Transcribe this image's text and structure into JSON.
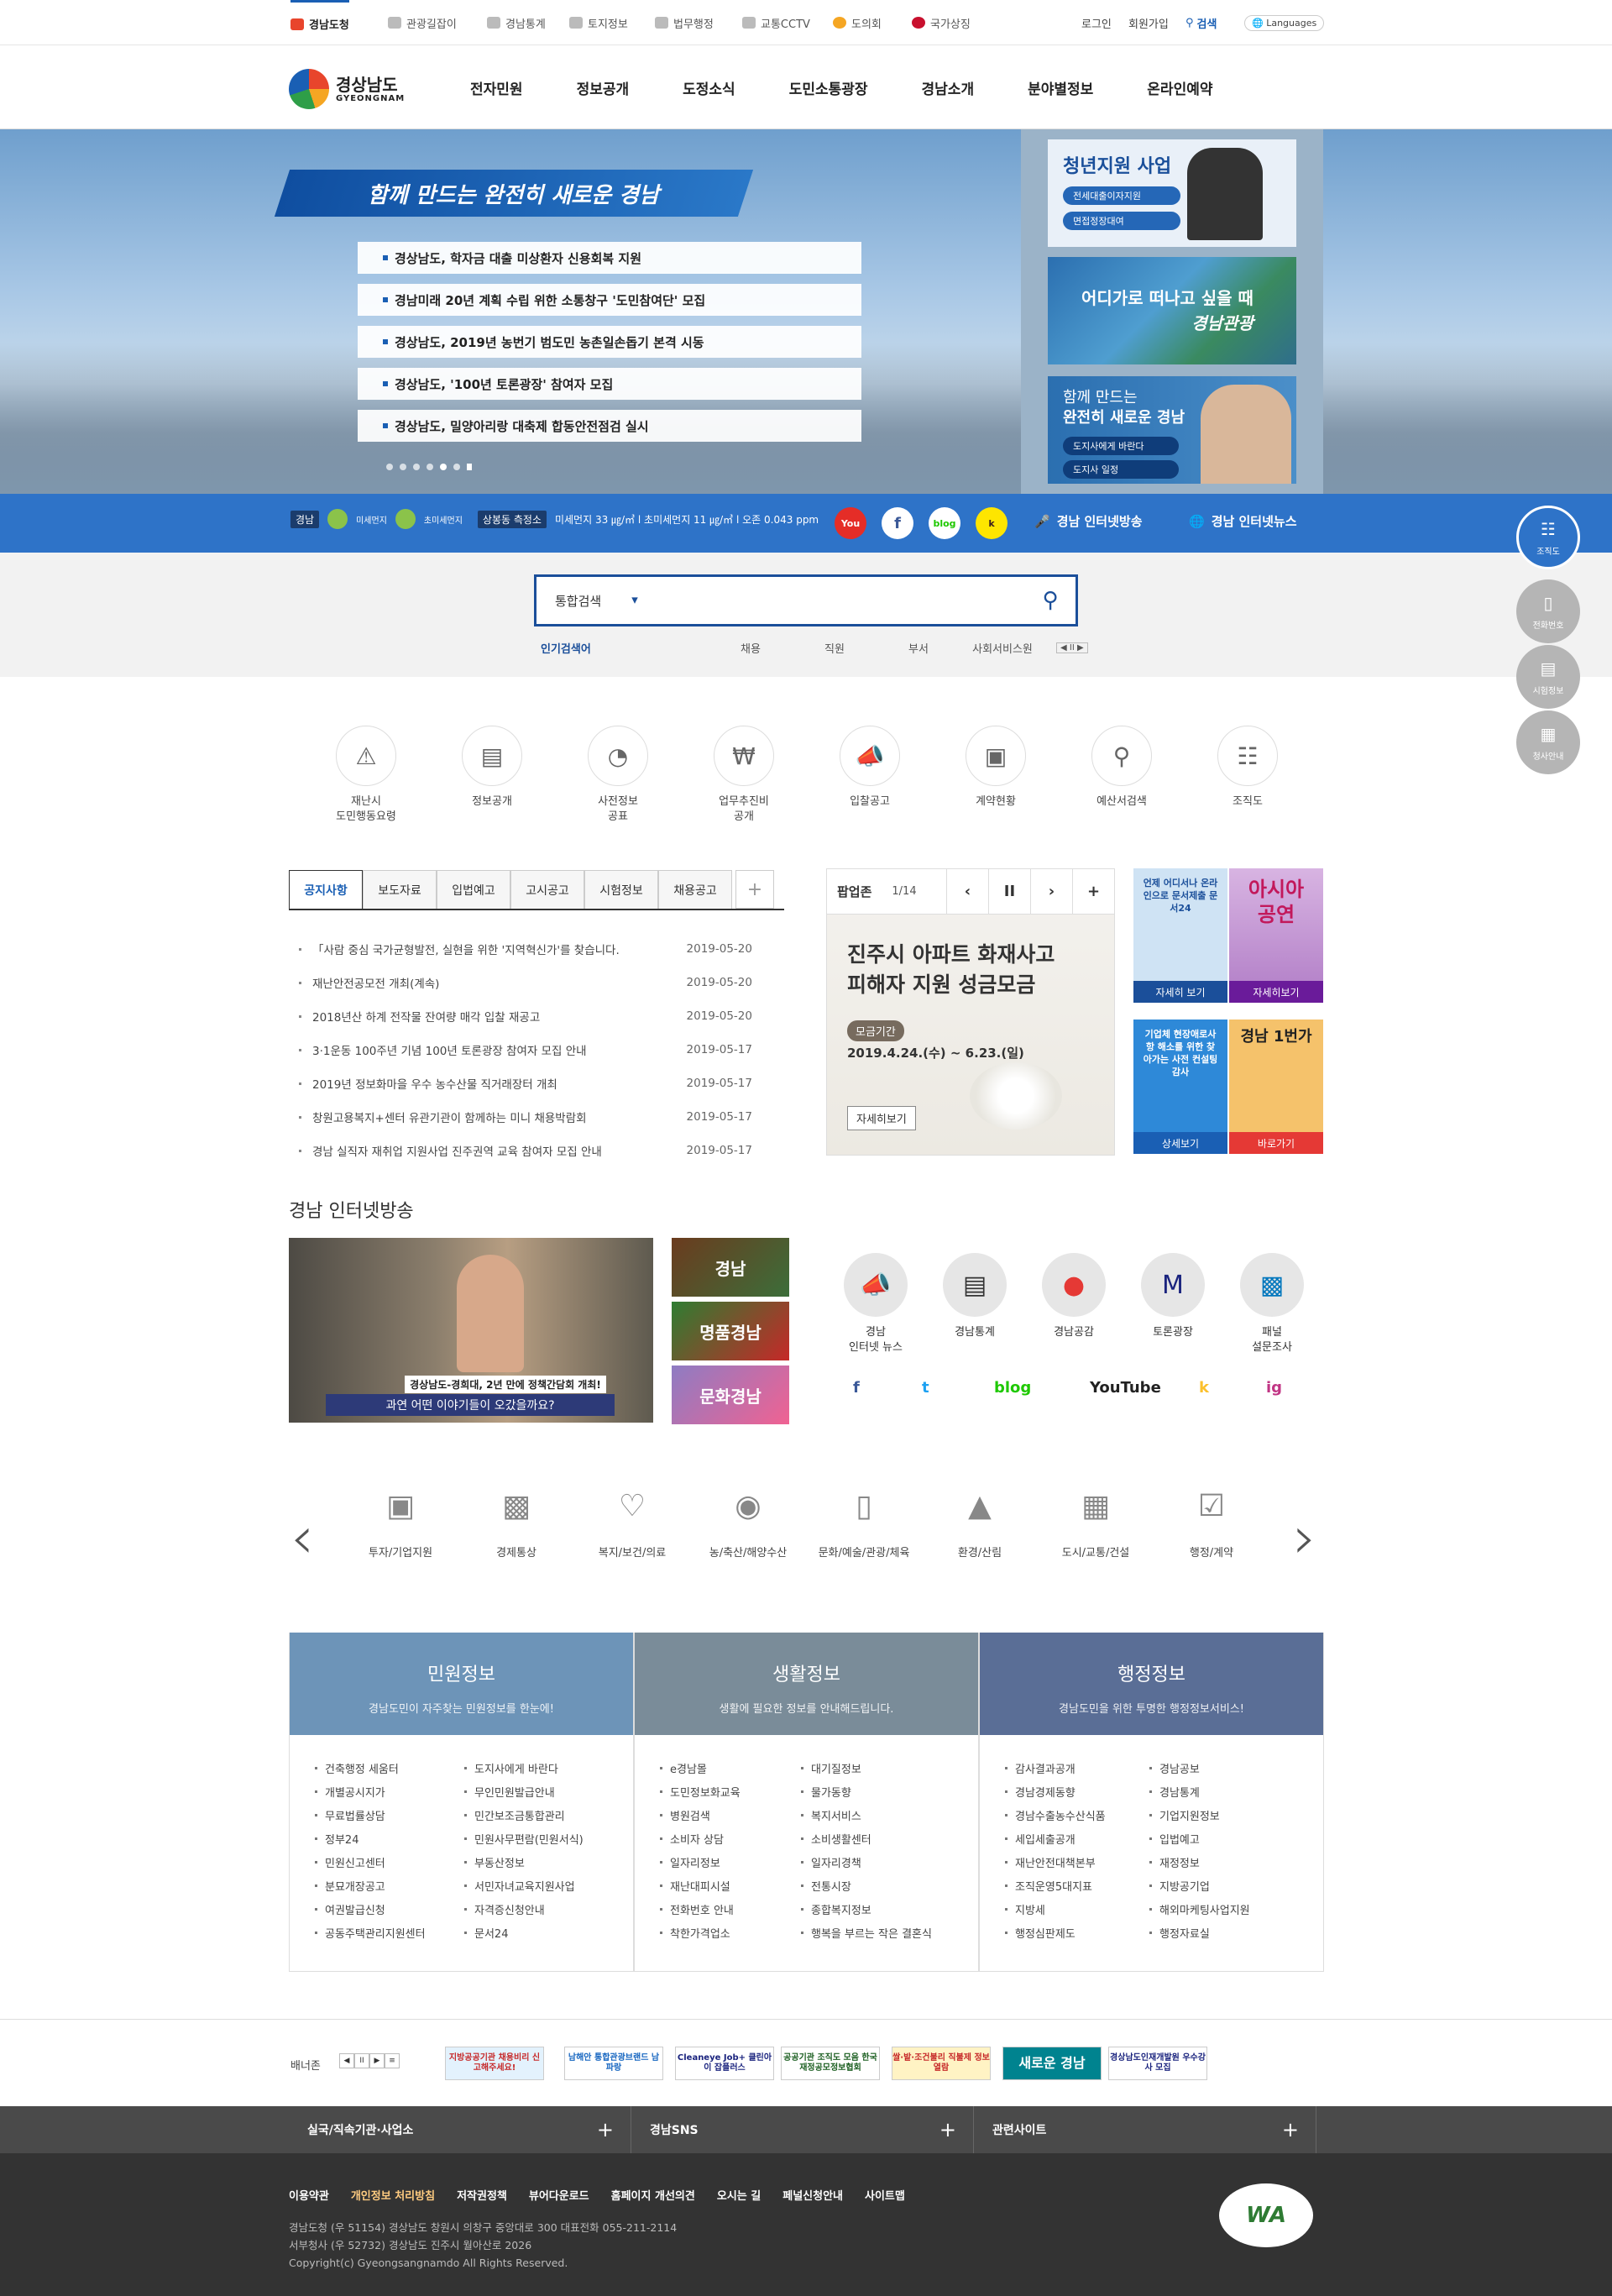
{
  "util": {
    "tabs": [
      {
        "label": "경남도청",
        "icon": "gyeongnam-logo-icon"
      },
      {
        "label": "관광길잡이",
        "icon": "camera-icon"
      },
      {
        "label": "경남통계",
        "icon": "bar-chart-icon"
      },
      {
        "label": "토지정보",
        "icon": "land-icon"
      },
      {
        "label": "법무행정",
        "icon": "scale-icon"
      },
      {
        "label": "교통CCTV",
        "icon": "car-icon"
      },
      {
        "label": "도의회",
        "icon": "assembly-icon"
      },
      {
        "label": "국가상징",
        "icon": "flag-icon"
      }
    ],
    "login": "로그인",
    "join": "회원가입",
    "search": "검색",
    "languages": "Languages"
  },
  "logo": {
    "kr": "경상남도",
    "en": "GYEONGNAM"
  },
  "menu": [
    "전자민원",
    "정보공개",
    "도정소식",
    "도민소통광장",
    "경남소개",
    "분야별정보",
    "온라인예약"
  ],
  "hero": {
    "slogan": "함께 만드는 완전히 새로운 경남",
    "news": [
      "경상남도, 학자금 대출 미상환자 신용회복 지원",
      "경남미래 20년 계획 수립 위한 소통창구 '도민참여단' 모집",
      "경상남도, 2019년 농번기 범도민 농촌일손돕기 본격 시동",
      "경상남도, '100년 토론광장' 참여자 모집",
      "경상남도, 밀양아리랑 대축제 합동안전점검 실시"
    ],
    "banner1": {
      "title": "청년지원 사업",
      "btn1": "전세대출이자지원",
      "btn2": "면접정장대여"
    },
    "banner2": {
      "text1": "어디가로 떠나고 싶을 때",
      "text2": "경남관광"
    },
    "banner3": {
      "text1": "함께 만드는",
      "text2": "완전히 새로운 경남",
      "btn1": "도지사에게 바란다",
      "btn2": "도지사 일정"
    }
  },
  "strip": {
    "brand": "경남",
    "icon1": "미세먼지",
    "icon2": "초미세먼지",
    "station": "상봉동 측정소",
    "air": "미세먼지 33 ㎍/㎥ l 초미세먼지 11 ㎍/㎥ l 오존 0.043 ppm",
    "link1": "경남 인터넷방송",
    "link2": "경남 인터넷뉴스"
  },
  "search": {
    "scope": "통합검색",
    "popular_label": "인기검색어",
    "keywords": [
      "채용",
      "직원",
      "부서",
      "사회서비스원"
    ]
  },
  "quick": [
    [
      "재난시",
      "도민행동요령"
    ],
    [
      "정보공개",
      ""
    ],
    [
      "사전정보",
      "공표"
    ],
    [
      "업무추진비",
      "공개"
    ],
    [
      "입찰공고",
      ""
    ],
    [
      "계약현황",
      ""
    ],
    [
      "예산서검색",
      ""
    ],
    [
      "조직도",
      ""
    ]
  ],
  "notice": {
    "tabs": [
      "공지사항",
      "보도자료",
      "입법예고",
      "고시공고",
      "시험정보",
      "채용공고"
    ],
    "items": [
      {
        "title": "「사람 중심 국가균형발전, 실현을 위한 '지역혁신가'를 찾습니다.",
        "date": "2019-05-20"
      },
      {
        "title": "재난안전공모전 개최(계속)",
        "date": "2019-05-20"
      },
      {
        "title": "2018년산 하계 전작물 잔여량 매각 입찰 재공고",
        "date": "2019-05-20"
      },
      {
        "title": "3·1운동 100주년 기념 100년 토론광장 참여자 모집 안내",
        "date": "2019-05-17"
      },
      {
        "title": "2019년 정보화마을 우수 농수산물 직거래장터 개최",
        "date": "2019-05-17"
      },
      {
        "title": "창원고용복지+센터 유관기관이 함께하는 미니 채용박람회",
        "date": "2019-05-17"
      },
      {
        "title": "경남 실직자 재취업 지원사업 진주권역 교육 참여자 모집 안내",
        "date": "2019-05-17"
      }
    ]
  },
  "popupzone": {
    "label": "팝업존",
    "page": "1/14",
    "title1": "진주시 아파트 화재사고",
    "title2": "피해자 지원 성금모금",
    "tag": "모금기간",
    "period": "2019.4.24.(수) ~ 6.23.(일)",
    "more": "자세히보기"
  },
  "side_banners": [
    {
      "text": "언제 어디서나 온라인으로 문서제출 문서24",
      "cap": "자세히 보기"
    },
    {
      "text": "아시아 공연",
      "cap": "자세히보기"
    },
    {
      "text": "기업체 현장애로사항 해소를 위한 찾아가는 사전 컨설팅감사",
      "cap": "상세보기"
    },
    {
      "text": "경남 1번가",
      "cap": "바로가기"
    }
  ],
  "broadcast": {
    "title": "경남 인터넷방송",
    "sub1": "경상남도-경희대, 2년 만에 정책간담회 개최!",
    "sub2": "과연 어떤 이야기들이 오갔을까요?",
    "thumbs": [
      "경남",
      "명품경남",
      "문화경남"
    ],
    "icons": [
      [
        "경남",
        "인터넷 뉴스"
      ],
      [
        "경남통계",
        ""
      ],
      [
        "경남공감",
        ""
      ],
      [
        "토론광장",
        ""
      ],
      [
        "패널",
        "설문조사"
      ]
    ],
    "sns": [
      "f",
      "t",
      "blog",
      "YouTube",
      "k",
      "ig"
    ]
  },
  "fields": [
    "투자/기업지원",
    "경제통상",
    "복지/보건/의료",
    "농/축산/해양수산",
    "문화/예술/관광/체육",
    "환경/산림",
    "도시/교통/건설",
    "행정/계약"
  ],
  "info": [
    {
      "title": "민원정보",
      "sub": "경남도민이 자주찾는 민원정보를 한눈에!",
      "color": "#6d94b8",
      "left": [
        "건축행정 세움터",
        "개별공시지가",
        "무료법률상담",
        "정부24",
        "민원신고센터",
        "분묘개장공고",
        "여권발급신청",
        "공동주택관리지원센터"
      ],
      "right": [
        "도지사에게 바란다",
        "무인민원발급안내",
        "민간보조금통합관리",
        "민원사무편람(민원서식)",
        "부동산정보",
        "서민자녀교육지원사업",
        "자격증신청안내",
        "문서24"
      ]
    },
    {
      "title": "생활정보",
      "sub": "생활에 필요한 정보를 안내해드립니다.",
      "color": "#7a8c99",
      "left": [
        "e경남몰",
        "도민정보화교육",
        "병원검색",
        "소비자 상담",
        "일자리정보",
        "재난대피시설",
        "전화번호 안내",
        "착한가격업소"
      ],
      "right": [
        "대기질정보",
        "물가동향",
        "복지서비스",
        "소비생활센터",
        "일자리경책",
        "전통시장",
        "종합복지정보",
        "행복을 부르는 작은 결혼식"
      ]
    },
    {
      "title": "행정정보",
      "sub": "경남도민을 위한 투명한 행정정보서비스!",
      "color": "#5a6e96",
      "left": [
        "감사결과공개",
        "경남경제동향",
        "경남수출농수산식품",
        "세입세출공개",
        "재난안전대책본부",
        "조직운영5대지표",
        "지방세",
        "행정심판제도"
      ],
      "right": [
        "경남공보",
        "경남통계",
        "기업지원정보",
        "입법예고",
        "재정정보",
        "지방공기업",
        "해외마케팅사업지원",
        "행정자료실"
      ]
    }
  ],
  "bannerzone": {
    "label": "배너존",
    "items": [
      "지방공공기관 채용비리 신고해주세요!",
      "남해안 통합관광브랜드 남파랑",
      "Cleaneye Job+ 클린아이 잡플러스",
      "공공기관 조직도 모음 한국재정공모정보협회",
      "쌀·밭·조건불리 직불제 정보열람",
      "새로운 경남",
      "경상남도인재개발원 우수강사 모집"
    ]
  },
  "footer_bar": [
    "실국/직속기관·사업소",
    "경남SNS",
    "관련사이트"
  ],
  "footer": {
    "links": [
      "이용약관",
      "개인정보 처리방침",
      "저작권정책",
      "뷰어다운로드",
      "홈페이지 개선의견",
      "오시는 길",
      "페널신청안내",
      "사이트맵"
    ],
    "addr1": "경남도청 (우 51154) 경상남도 창원시 의창구 중앙대로 300 대표전화 055-211-2114",
    "addr2": "서부청사 (우 52732) 경상남도 진주시 월아산로 2026",
    "copyright": "Copyright(c) Gyeongsangnamdo All Rights Reserved.",
    "wa": "WA"
  },
  "floating": [
    "조직도",
    "전화번호",
    "시험정보",
    "청사안내"
  ]
}
